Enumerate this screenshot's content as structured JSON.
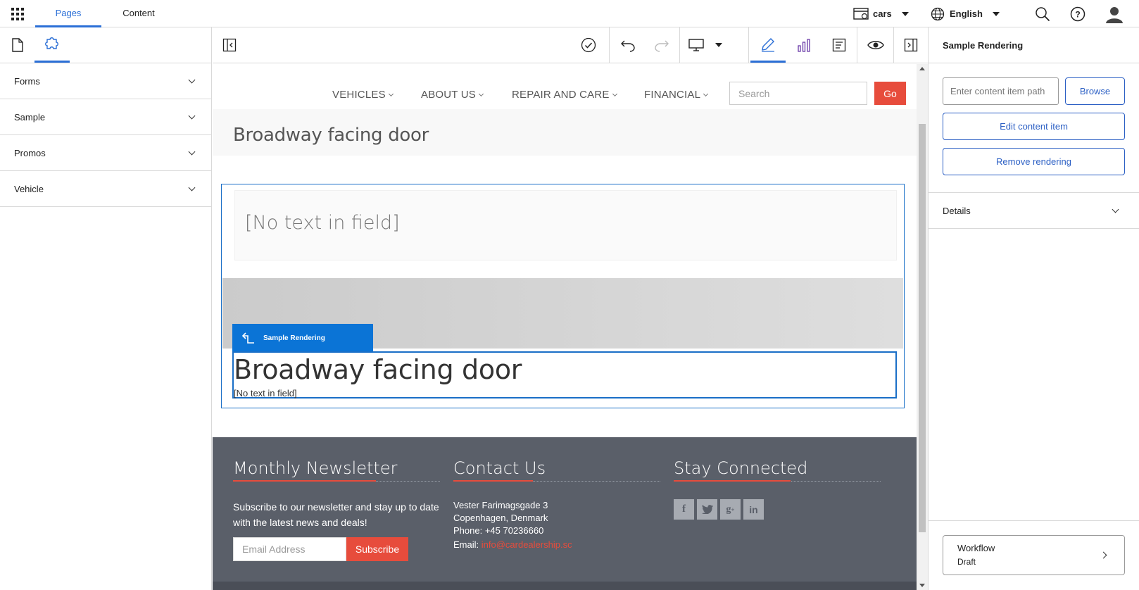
{
  "topbar": {
    "tabs": [
      {
        "label": "Pages"
      },
      {
        "label": "Content"
      }
    ],
    "site": {
      "label": "cars"
    },
    "language": {
      "label": "English"
    }
  },
  "left_panel": {
    "sections": [
      {
        "label": "Forms"
      },
      {
        "label": "Sample"
      },
      {
        "label": "Promos"
      },
      {
        "label": "Vehicle"
      }
    ]
  },
  "canvas": {
    "nav": {
      "items": [
        {
          "label": "VEHICLES"
        },
        {
          "label": "ABOUT US"
        },
        {
          "label": "REPAIR AND CARE"
        },
        {
          "label": "FINANCIAL"
        }
      ],
      "search_placeholder": "Search",
      "go_label": "Go"
    },
    "page_title": "Broadway facing door",
    "placeholder_field": "[No text in field]",
    "chip_label": "Sample Rendering",
    "rendering_title": "Broadway facing door",
    "rendering_text": "[No text in field]",
    "footer": {
      "newsletter": {
        "heading": "Monthly Newsletter",
        "text": "Subscribe to our newsletter and stay up to date with the latest news and deals!",
        "email_placeholder": "Email Address",
        "subscribe_label": "Subscribe"
      },
      "contact": {
        "heading": "Contact Us",
        "line1": "Vester Farimagsgade 3",
        "line2": "Copenhagen, Denmark",
        "phone": "Phone: +45 70236660",
        "email_label": "Email:",
        "email": "info@cardealership.sc"
      },
      "social": {
        "heading": "Stay Connected",
        "icons": [
          "facebook-icon",
          "twitter-icon",
          "google-plus-icon",
          "linkedin-icon"
        ]
      }
    }
  },
  "right_panel": {
    "title": "Sample Rendering",
    "path_placeholder": "Enter content item path",
    "browse_label": "Browse",
    "edit_label": "Edit content item",
    "remove_label": "Remove rendering",
    "details_label": "Details",
    "workflow": {
      "title": "Workflow",
      "status": "Draft"
    }
  },
  "colors": {
    "accent": "#2b6fd6",
    "brand_red": "#e74c3c",
    "footer_bg": "#5a5f69",
    "selection_blue": "#1a6fc7"
  }
}
